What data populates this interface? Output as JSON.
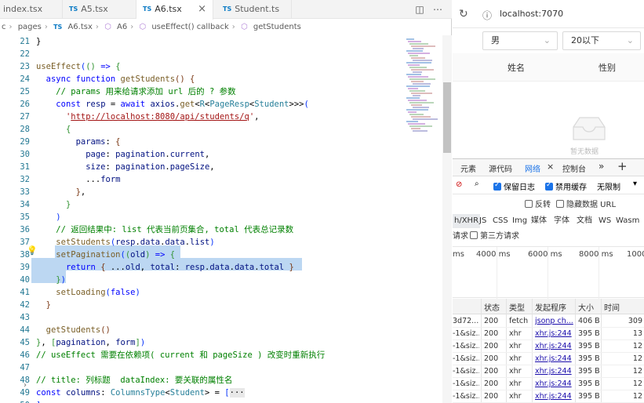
{
  "editor": {
    "tabs": [
      {
        "label": "index.tsx",
        "ts": false
      },
      {
        "label": "A5.tsx",
        "ts": true
      },
      {
        "label": "A6.tsx",
        "ts": true,
        "active": true
      },
      {
        "label": "Student.ts",
        "ts": true
      }
    ],
    "tab_badge": "TS",
    "breadcrumbs": [
      "c",
      "pages",
      "A6.tsx",
      "A6",
      "useEffect() callback",
      "getStudents"
    ],
    "line_numbers": [
      "21",
      "22",
      "23",
      "24",
      "25",
      "26",
      "27",
      "28",
      "29",
      "30",
      "31",
      "32",
      "33",
      "34",
      "35",
      "36",
      "37",
      "38",
      "39",
      "40",
      "41",
      "42",
      "43",
      "44",
      "45",
      "46",
      "47",
      "48",
      "49",
      "50"
    ]
  },
  "browser": {
    "url": "localhost:7070",
    "filter_gender": "男",
    "filter_age": "20以下",
    "col_name": "姓名",
    "col_gender": "性别",
    "empty_text": "暂无数据"
  },
  "devtools": {
    "tabs": [
      "元素",
      "源代码",
      "网络",
      "控制台"
    ],
    "preserve_log": "保留日志",
    "disable_cache": "禁用缓存",
    "throttle": "无限制",
    "invert": "反转",
    "hide_data_url": "隐藏数据 URL",
    "type_filters": [
      "h/XHR",
      "JS",
      "CSS",
      "Img",
      "媒体",
      "字体",
      "文档",
      "WS",
      "Wasm"
    ],
    "blocked_requests": "请求",
    "third_party": "第三方请求",
    "ticks": [
      "ms",
      "4000 ms",
      "6000 ms",
      "8000 ms",
      "1000"
    ],
    "columns": [
      "状态",
      "类型",
      "发起程序",
      "大小",
      "时间"
    ],
    "rows": [
      {
        "name": "3d72...",
        "status": "200",
        "type": "fetch",
        "initiator": "jsonp ch...",
        "size": "406 B",
        "time": "309"
      },
      {
        "name": "-1&siz...",
        "status": "200",
        "type": "xhr",
        "initiator": "xhr.js:244",
        "size": "395 B",
        "time": "13"
      },
      {
        "name": "-1&siz...",
        "status": "200",
        "type": "xhr",
        "initiator": "xhr.js:244",
        "size": "395 B",
        "time": "12"
      },
      {
        "name": "-1&siz...",
        "status": "200",
        "type": "xhr",
        "initiator": "xhr.js:244",
        "size": "395 B",
        "time": "12"
      },
      {
        "name": "-1&siz...",
        "status": "200",
        "type": "xhr",
        "initiator": "xhr.js:244",
        "size": "395 B",
        "time": "12"
      },
      {
        "name": "-1&siz...",
        "status": "200",
        "type": "xhr",
        "initiator": "xhr.js:244",
        "size": "395 B",
        "time": "12"
      },
      {
        "name": "-1&siz...",
        "status": "200",
        "type": "xhr",
        "initiator": "xhr.js:244",
        "size": "395 B",
        "time": "12"
      },
      {
        "name": "-1&siz...",
        "status": "200",
        "type": "xhr",
        "initiator": "xhr.js:244",
        "size": "395 B",
        "time": "12"
      }
    ]
  }
}
